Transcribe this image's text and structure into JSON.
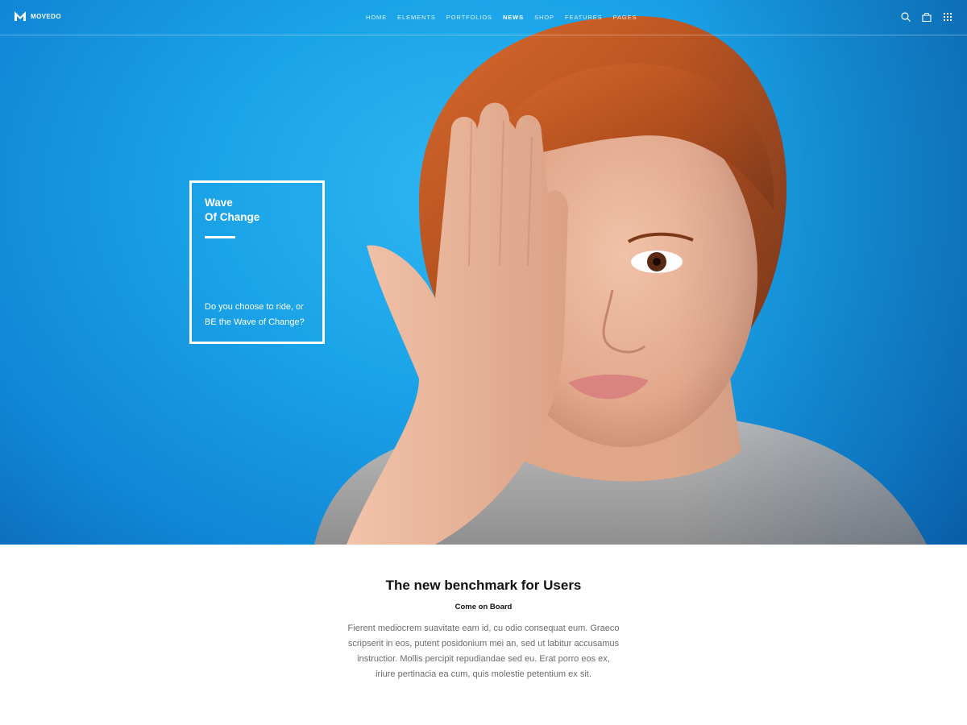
{
  "brand": {
    "name": "MOVEDO",
    "logo_icon": "m-logo-icon"
  },
  "nav": {
    "items": [
      {
        "label": "HOME",
        "active": false
      },
      {
        "label": "ELEMENTS",
        "active": false
      },
      {
        "label": "PORTFOLIOS",
        "active": false
      },
      {
        "label": "NEWS",
        "active": true
      },
      {
        "label": "SHOP",
        "active": false
      },
      {
        "label": "FEATURES",
        "active": false
      },
      {
        "label": "PAGES",
        "active": false
      }
    ]
  },
  "header_icons": [
    "search-icon",
    "cart-icon",
    "grid-menu-icon"
  ],
  "hero": {
    "title": "Wave\nOf Change",
    "text": "Do you choose to ride, or BE the Wave of Change?",
    "background_color": "#1aa3e8"
  },
  "content": {
    "title": "The new benchmark for Users",
    "subtitle": "Come on Board",
    "body": "Fierent mediocrem suavitate eam id, cu odio consequat eum. Graeco scripserit in eos, putent posidonium mei an, sed ut labitur accusamus instructior. Mollis percipit repudiandae sed eu. Erat porro eos ex, iriure pertinacia ea cum, quis molestie petentium ex sit."
  }
}
